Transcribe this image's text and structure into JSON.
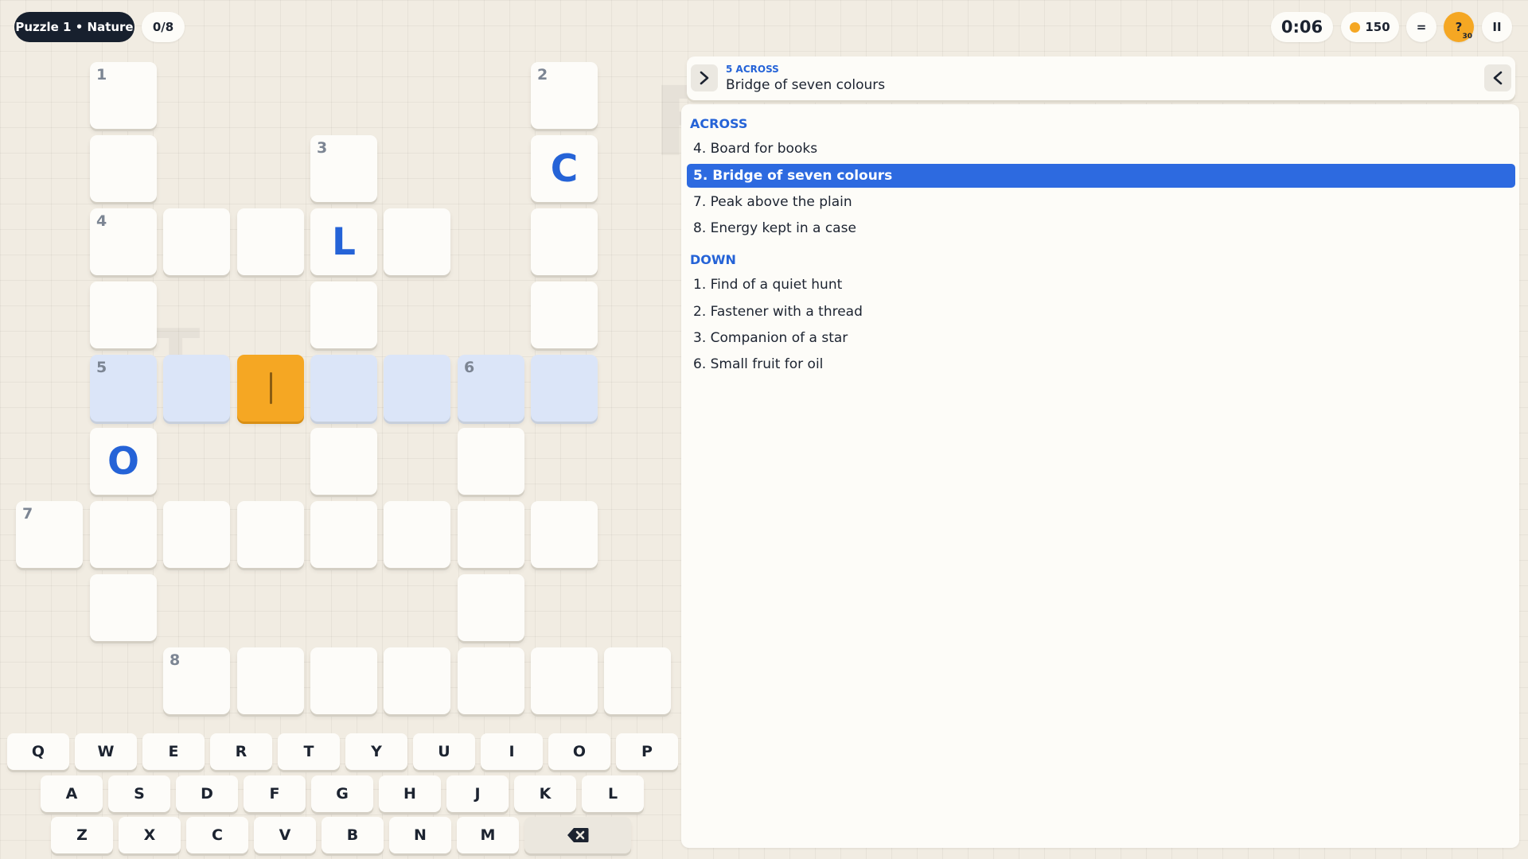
{
  "header": {
    "puzzle_label": "Puzzle 1 • Nature",
    "progress": "0/8",
    "timer": "0:06",
    "coins": "150",
    "menu_icon": "=",
    "hint_icon": "?",
    "hint_count": "30",
    "pause_icon": "II"
  },
  "grid": {
    "num_1": "1",
    "num_2": "2",
    "num_3": "3",
    "num_4": "4",
    "num_5": "5",
    "num_6": "6",
    "num_7": "7",
    "num_8": "8",
    "letter_c": "C",
    "letter_l": "L",
    "letter_o": "O"
  },
  "keyboard": {
    "row1": [
      "Q",
      "W",
      "E",
      "R",
      "T",
      "Y",
      "U",
      "I",
      "O",
      "P"
    ],
    "row2": [
      "A",
      "S",
      "D",
      "F",
      "G",
      "H",
      "J",
      "K",
      "L"
    ],
    "row3": [
      "Z",
      "X",
      "C",
      "V",
      "B",
      "N",
      "M"
    ],
    "backspace_icon": "backspace-icon"
  },
  "clue_bar": {
    "tag": "5 ACROSS",
    "text": "Bridge of seven colours"
  },
  "clues": {
    "across_heading": "ACROSS",
    "across": [
      "4. Board for books",
      "5. Bridge of seven colours",
      "7. Peak above the plain",
      "8. Energy kept in a case"
    ],
    "down_heading": "DOWN",
    "down": [
      "1. Find of a quiet hunt",
      "2. Fastener with a thread",
      "3. Companion of a star",
      "6. Small fruit for oil"
    ]
  },
  "colors": {
    "accent": "#2563d7",
    "active_cell": "#f5a723",
    "highlight_cell": "#dbe5f8",
    "selected_clue": "#2d6ae0"
  }
}
